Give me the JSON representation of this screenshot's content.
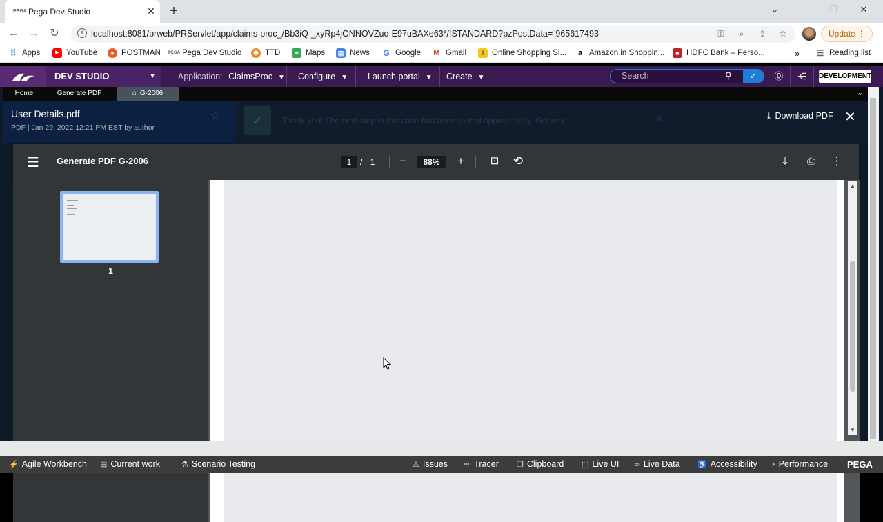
{
  "browser": {
    "tab_favicon": "PEGA",
    "tab_title": "Pega Dev Studio",
    "url": "localhost:8081/prweb/PRServlet/app/claims-proc_/Bb3iQ-_xyRp4jONNOVZuo-E97uBAXe63*/!STANDARD?pzPostData=-965617493",
    "update_label": "Update",
    "bookmarks": [
      {
        "label": "Apps",
        "icon": "apps-grid-icon"
      },
      {
        "label": "YouTube",
        "icon": "youtube-icon"
      },
      {
        "label": "POSTMAN",
        "icon": "postman-icon"
      },
      {
        "label": "Pega Dev Studio",
        "icon": "pega-icon"
      },
      {
        "label": "TTD",
        "icon": "ttd-icon"
      },
      {
        "label": "Maps",
        "icon": "maps-icon"
      },
      {
        "label": "News",
        "icon": "news-icon"
      },
      {
        "label": "Google",
        "icon": "google-icon"
      },
      {
        "label": "Gmail",
        "icon": "gmail-icon"
      },
      {
        "label": "Online Shopping Si...",
        "icon": "shopping-icon"
      },
      {
        "label": "Amazon.in Shoppin...",
        "icon": "amazon-icon"
      },
      {
        "label": "HDFC Bank – Perso...",
        "icon": "hdfc-icon"
      }
    ],
    "more_bookmarks": "»",
    "reading_list": "Reading list"
  },
  "pega": {
    "studio": "DEV STUDIO",
    "application_label": "Application:",
    "application_value": "ClaimsProc",
    "menus": [
      "Configure",
      "Launch portal",
      "Create"
    ],
    "search_placeholder": "Search",
    "environment": "DEVELOPMENT",
    "colors": {
      "header": "#3b1a52",
      "accent": "#1e7fd8"
    }
  },
  "subtabs": [
    {
      "label": "Home"
    },
    {
      "label": "Generate PDF"
    },
    {
      "label": "G-2006",
      "active": true
    }
  ],
  "viewer": {
    "file_name": "User Details.pdf",
    "file_meta": "PDF | Jan 29, 2022 12:21 PM EST by author",
    "ghost_message": "Thank you! The next step in this case has been routed appropriately.   Get nex",
    "download_label": "Download PDF"
  },
  "pdf": {
    "title": "Generate PDF G-2006",
    "current_page": "1",
    "page_separator": "/",
    "total_pages": "1",
    "zoom": "88%",
    "thumbnail_label": "1"
  },
  "footer": {
    "left": [
      {
        "label": "Agile Workbench",
        "icon": "agile-workbench-icon"
      },
      {
        "label": "Current work",
        "icon": "clipboard-list-icon"
      },
      {
        "label": "Scenario Testing",
        "icon": "flask-icon"
      }
    ],
    "right": [
      {
        "label": "Issues",
        "icon": "warning-icon"
      },
      {
        "label": "Tracer",
        "icon": "tracer-icon"
      },
      {
        "label": "Clipboard",
        "icon": "clipboard-icon"
      },
      {
        "label": "Live UI",
        "icon": "live-ui-icon"
      },
      {
        "label": "Live Data",
        "icon": "live-data-icon"
      },
      {
        "label": "Accessibility",
        "icon": "accessibility-icon"
      },
      {
        "label": "Performance",
        "icon": "performance-icon"
      }
    ],
    "brand": "PEGA"
  }
}
